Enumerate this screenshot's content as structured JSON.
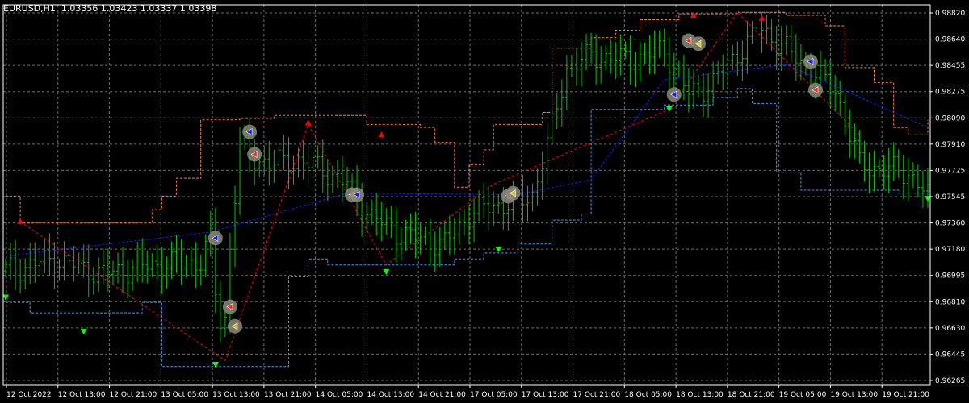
{
  "header": {
    "symbol": "EURUSD,H1",
    "ohlc": "1.03356 1.03423 1.03337 1.03398"
  },
  "colors": {
    "background": "#000000",
    "grid": "#6e6e6e",
    "axis": "#ffffff",
    "candle": "#00c800",
    "signal_up": "#00ff00",
    "signal_down": "#ff0000",
    "upper_band": "#ff7f2a",
    "lower_band": "#3399ff",
    "trend_line": "#1a1aff",
    "zigzag": "#ff0000"
  },
  "icons": {
    "trade_marker": "circle-arrow-icon",
    "up_signal": "green-down-arrow-icon",
    "down_signal": "red-up-arrow-icon"
  },
  "chart_data": {
    "type": "candlestick",
    "title": "EURUSD,H1",
    "grid": true,
    "ylim": [
      0.96275,
      0.9882
    ],
    "y_ticks": [
      "0.98820",
      "0.98640",
      "0.98455",
      "0.98275",
      "0.98090",
      "0.97910",
      "0.97725",
      "0.97545",
      "0.97360",
      "0.97180",
      "0.96995",
      "0.96810",
      "0.96630",
      "0.96445",
      "0.96265"
    ],
    "x_ticks": [
      "12 Oct 2022",
      "12 Oct 13:00",
      "12 Oct 21:00",
      "13 Oct 05:00",
      "13 Oct 13:00",
      "13 Oct 21:00",
      "14 Oct 05:00",
      "14 Oct 13:00",
      "14 Oct 21:00",
      "17 Oct 05:00",
      "17 Oct 13:00",
      "17 Oct 21:00",
      "18 Oct 05:00",
      "18 Oct 13:00",
      "18 Oct 21:00",
      "19 Oct 05:00",
      "19 Oct 13:00",
      "19 Oct 21:00"
    ],
    "bar_count": 190,
    "close_anchors": [
      [
        0,
        0.9704
      ],
      [
        10,
        0.9712
      ],
      [
        20,
        0.9702
      ],
      [
        30,
        0.9708
      ],
      [
        40,
        0.971
      ],
      [
        42,
        0.9726
      ],
      [
        43,
        0.969
      ],
      [
        44,
        0.967
      ],
      [
        45,
        0.9672
      ],
      [
        46,
        0.972
      ],
      [
        48,
        0.979
      ],
      [
        50,
        0.978
      ],
      [
        55,
        0.9776
      ],
      [
        60,
        0.9778
      ],
      [
        65,
        0.9772
      ],
      [
        70,
        0.9762
      ],
      [
        72,
        0.9752
      ],
      [
        75,
        0.974
      ],
      [
        80,
        0.973
      ],
      [
        85,
        0.9725
      ],
      [
        90,
        0.9722
      ],
      [
        95,
        0.9742
      ],
      [
        100,
        0.9748
      ],
      [
        105,
        0.975
      ],
      [
        108,
        0.9755
      ],
      [
        112,
        0.98
      ],
      [
        115,
        0.984
      ],
      [
        120,
        0.9848
      ],
      [
        128,
        0.9845
      ],
      [
        135,
        0.9852
      ],
      [
        140,
        0.9822
      ],
      [
        145,
        0.983
      ],
      [
        150,
        0.985
      ],
      [
        155,
        0.9866
      ],
      [
        160,
        0.9852
      ],
      [
        165,
        0.9838
      ],
      [
        170,
        0.9825
      ],
      [
        175,
        0.9775
      ],
      [
        180,
        0.9772
      ],
      [
        185,
        0.977
      ],
      [
        189,
        0.9754
      ]
    ],
    "upper_band": [
      [
        0,
        0.9754
      ],
      [
        3,
        0.9736
      ],
      [
        10,
        0.9736
      ],
      [
        18,
        0.9736
      ],
      [
        28,
        0.9736
      ],
      [
        30,
        0.9745
      ],
      [
        32,
        0.9754
      ],
      [
        35,
        0.9766
      ],
      [
        40,
        0.9805
      ],
      [
        48,
        0.9806
      ],
      [
        55,
        0.9808
      ],
      [
        60,
        0.9808
      ],
      [
        70,
        0.9808
      ],
      [
        74,
        0.9802
      ],
      [
        85,
        0.98
      ],
      [
        88,
        0.979
      ],
      [
        92,
        0.976
      ],
      [
        95,
        0.9775
      ],
      [
        98,
        0.9785
      ],
      [
        100,
        0.9802
      ],
      [
        110,
        0.981
      ],
      [
        112,
        0.9853
      ],
      [
        120,
        0.986
      ],
      [
        125,
        0.9865
      ],
      [
        130,
        0.9872
      ],
      [
        138,
        0.9876
      ],
      [
        150,
        0.9877
      ],
      [
        160,
        0.9875
      ],
      [
        168,
        0.9868
      ],
      [
        172,
        0.984
      ],
      [
        178,
        0.983
      ],
      [
        182,
        0.98
      ],
      [
        185,
        0.9795
      ],
      [
        189,
        0.9805
      ]
    ],
    "lower_band": [
      [
        0,
        0.9683
      ],
      [
        5,
        0.9676
      ],
      [
        15,
        0.9676
      ],
      [
        26,
        0.9676
      ],
      [
        28,
        0.9683
      ],
      [
        32,
        0.964
      ],
      [
        43,
        0.964
      ],
      [
        55,
        0.964
      ],
      [
        58,
        0.97
      ],
      [
        62,
        0.9712
      ],
      [
        66,
        0.9708
      ],
      [
        78,
        0.9708
      ],
      [
        92,
        0.9712
      ],
      [
        98,
        0.9716
      ],
      [
        105,
        0.9722
      ],
      [
        112,
        0.9738
      ],
      [
        118,
        0.9742
      ],
      [
        120,
        0.9812
      ],
      [
        128,
        0.9812
      ],
      [
        135,
        0.9815
      ],
      [
        140,
        0.9815
      ],
      [
        145,
        0.982
      ],
      [
        150,
        0.9826
      ],
      [
        153,
        0.9816
      ],
      [
        158,
        0.977
      ],
      [
        163,
        0.9758
      ],
      [
        175,
        0.9758
      ],
      [
        183,
        0.9756
      ],
      [
        189,
        0.9754
      ]
    ],
    "trend_line": [
      [
        0,
        0.9714
      ],
      [
        42,
        0.973
      ],
      [
        70,
        0.9756
      ],
      [
        105,
        0.9755
      ],
      [
        120,
        0.9765
      ],
      [
        135,
        0.9832
      ],
      [
        160,
        0.9842
      ],
      [
        189,
        0.98
      ]
    ],
    "zigzag": [
      [
        3,
        0.9737
      ],
      [
        45,
        0.9644
      ],
      [
        62,
        0.9802
      ],
      [
        78,
        0.9708
      ],
      [
        100,
        0.9762
      ],
      [
        136,
        0.9812
      ],
      [
        150,
        0.9877
      ],
      [
        175,
        0.9795
      ]
    ],
    "up_arrows": [
      [
        0,
        0.9686
      ],
      [
        16,
        0.9663
      ],
      [
        43,
        0.9641
      ],
      [
        78,
        0.9703
      ],
      [
        101,
        0.9718
      ],
      [
        136,
        0.9812
      ],
      [
        189,
        0.9752
      ]
    ],
    "down_arrows": [
      [
        3,
        0.9737
      ],
      [
        62,
        0.9803
      ],
      [
        77,
        0.9795
      ],
      [
        141,
        0.9875
      ],
      [
        155,
        0.9873
      ]
    ],
    "trade_markers": [
      [
        43,
        0.9726
      ],
      [
        46,
        0.968
      ],
      [
        47,
        0.9667
      ],
      [
        50,
        0.9797
      ],
      [
        51,
        0.9782
      ],
      [
        71,
        0.9755
      ],
      [
        72,
        0.9755
      ],
      [
        103,
        0.9754
      ],
      [
        104,
        0.9756
      ],
      [
        137,
        0.9822
      ],
      [
        140,
        0.9858
      ],
      [
        142,
        0.9856
      ],
      [
        165,
        0.9844
      ],
      [
        166,
        0.9825
      ]
    ]
  }
}
